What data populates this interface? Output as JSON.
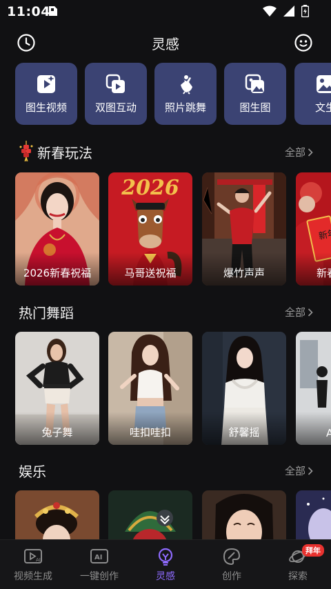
{
  "status": {
    "time": "11:04"
  },
  "header": {
    "title": "灵感"
  },
  "quick_tools": [
    {
      "label": "图生视频",
      "icon": "play-square-icon"
    },
    {
      "label": "双图互动",
      "icon": "copy-play-icon"
    },
    {
      "label": "照片跳舞",
      "icon": "dancer-icon"
    },
    {
      "label": "图生图",
      "icon": "images-icon"
    },
    {
      "label": "文生",
      "icon": "image-icon"
    }
  ],
  "sections": [
    {
      "title": "新春玩法",
      "all_label": "全部",
      "cards": [
        {
          "label": "2026新春祝福"
        },
        {
          "label": "马哥送祝福",
          "banner": "2026"
        },
        {
          "label": "爆竹声声"
        },
        {
          "label": "新春",
          "couplet": "新年快"
        }
      ]
    },
    {
      "title": "热门舞蹈",
      "all_label": "全部",
      "cards": [
        {
          "label": "兔子舞"
        },
        {
          "label": "哇扣哇扣"
        },
        {
          "label": "舒馨摇"
        },
        {
          "label": "A"
        }
      ]
    },
    {
      "title": "娱乐",
      "all_label": "全部",
      "cards": [
        {
          "label": ""
        },
        {
          "label": ""
        },
        {
          "label": ""
        },
        {
          "label": ""
        }
      ]
    }
  ],
  "bottom_nav": [
    {
      "label": "视频生成",
      "icon": "video-ai-icon"
    },
    {
      "label": "一键创作",
      "icon": "ai-box-icon"
    },
    {
      "label": "灵感",
      "icon": "lightbulb-icon",
      "active": true
    },
    {
      "label": "创作",
      "icon": "palette-icon"
    },
    {
      "label": "探索",
      "icon": "planet-icon",
      "badge": "拜年"
    }
  ],
  "colors": {
    "background": "#111113",
    "tool_card": "#3b4373",
    "active_nav": "#8f6bff",
    "badge": "#e8322f"
  }
}
